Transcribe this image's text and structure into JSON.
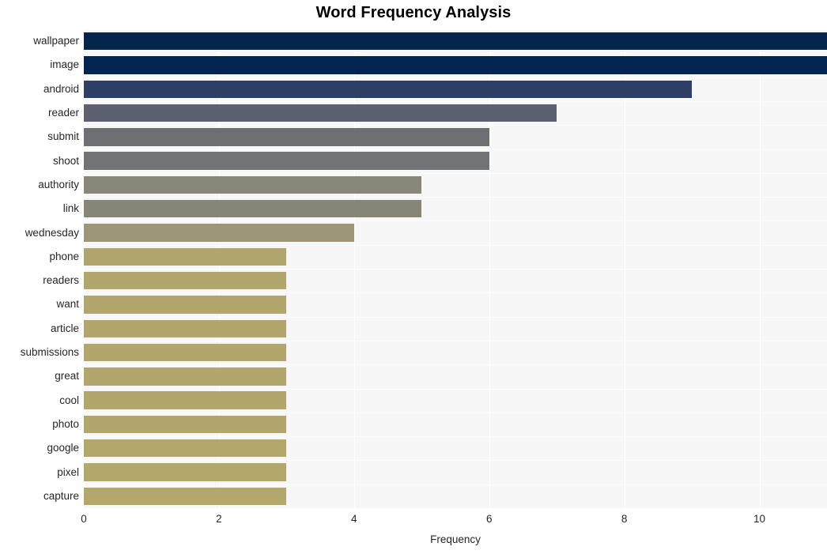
{
  "chart_data": {
    "type": "bar",
    "orientation": "horizontal",
    "title": "Word Frequency Analysis",
    "xlabel": "Frequency",
    "ylabel": "",
    "xlim": [
      0,
      11
    ],
    "ylim": null,
    "grid": true,
    "legend": null,
    "x_ticks": [
      "0",
      "2",
      "4",
      "6",
      "8",
      "10"
    ],
    "x_tick_values": [
      0,
      2,
      4,
      6,
      8,
      10
    ],
    "categories": [
      "wallpaper",
      "image",
      "android",
      "reader",
      "submit",
      "shoot",
      "authority",
      "link",
      "wednesday",
      "phone",
      "readers",
      "want",
      "article",
      "submissions",
      "great",
      "cool",
      "photo",
      "google",
      "pixel",
      "capture"
    ],
    "values": [
      11,
      11,
      9,
      7,
      6,
      6,
      5,
      5,
      4,
      3,
      3,
      3,
      3,
      3,
      3,
      3,
      3,
      3,
      3,
      3
    ],
    "bar_colors": [
      "#06254c",
      "#032350",
      "#2e3f66",
      "#5c6070",
      "#6e6f72",
      "#727375",
      "#888779",
      "#868578",
      "#9c9676",
      "#b0a56d",
      "#b2a66d",
      "#b2a66d",
      "#b2a66d",
      "#b2a66d",
      "#b2a66d",
      "#b2a66d",
      "#b2a66d",
      "#b3a76c",
      "#b3a76c",
      "#b3a76c"
    ],
    "plot_background": "#f7f7f7",
    "gridline_color": "#ffffff",
    "figure_background": "#ffffff",
    "tick_label_color": "#262626",
    "title_color": "#000000"
  }
}
